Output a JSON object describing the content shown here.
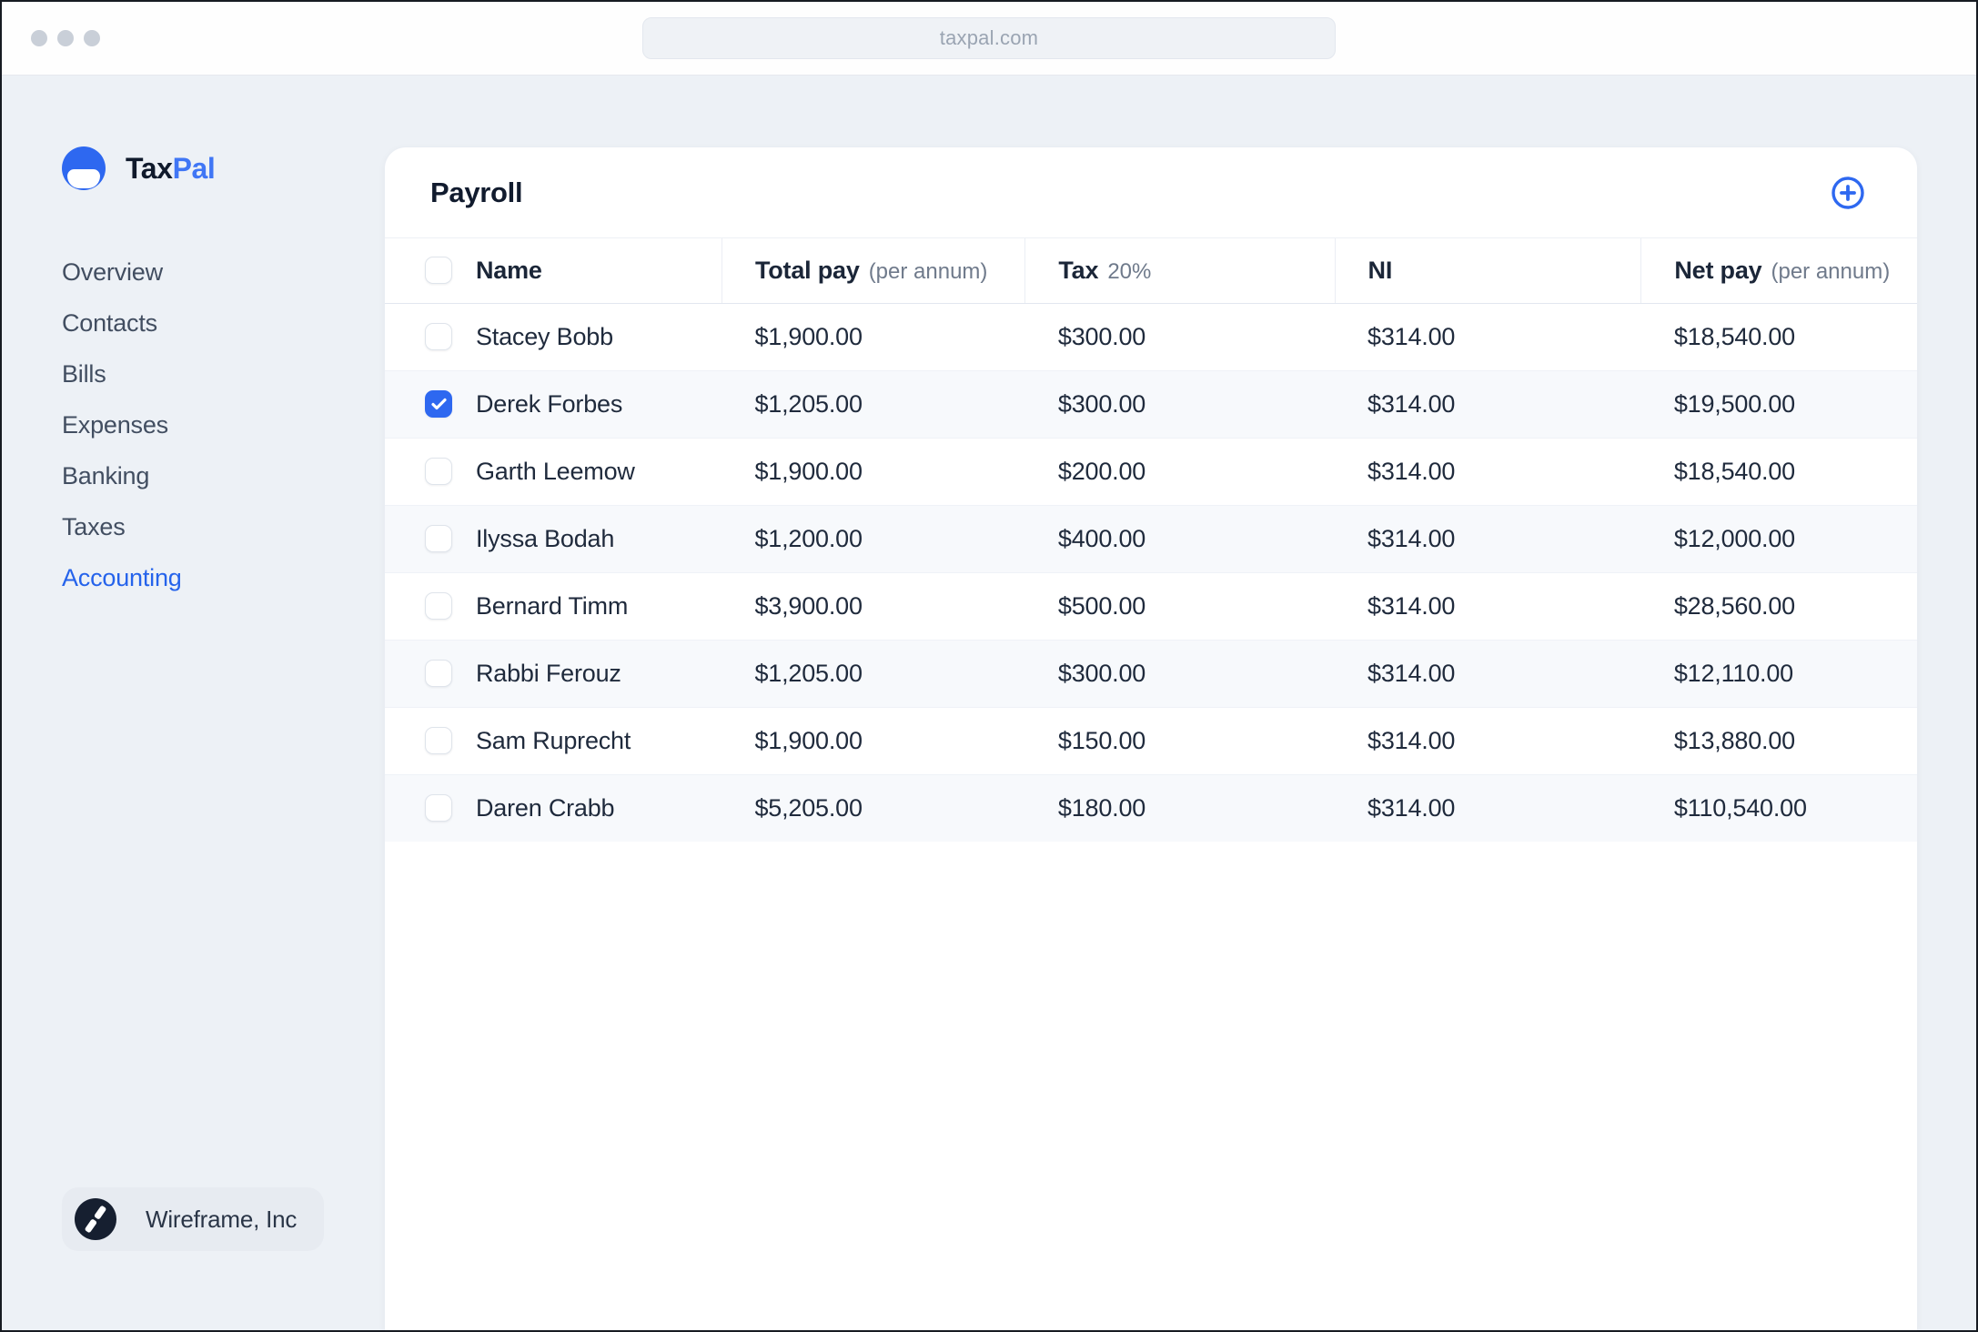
{
  "browser": {
    "url": "taxpal.com"
  },
  "brand": {
    "name_primary": "Tax",
    "name_secondary": "Pal",
    "logo_icon": "blue-circle-smile-icon"
  },
  "sidebar": {
    "items": [
      {
        "label": "Overview",
        "active": false
      },
      {
        "label": "Contacts",
        "active": false
      },
      {
        "label": "Bills",
        "active": false
      },
      {
        "label": "Expenses",
        "active": false
      },
      {
        "label": "Banking",
        "active": false
      },
      {
        "label": "Taxes",
        "active": false
      },
      {
        "label": "Accounting",
        "active": true
      }
    ],
    "org": {
      "name": "Wireframe, Inc",
      "logo_icon": "dark-circle-double-slash-icon"
    }
  },
  "main": {
    "title": "Payroll",
    "add_button_icon": "circle-plus-icon",
    "table": {
      "columns": [
        {
          "label": "Name",
          "sub": ""
        },
        {
          "label": "Total pay",
          "sub": "(per annum)"
        },
        {
          "label": "Tax",
          "sub": "20%"
        },
        {
          "label": "NI",
          "sub": ""
        },
        {
          "label": "Net pay",
          "sub": "(per annum)"
        }
      ],
      "rows": [
        {
          "checked": false,
          "name": "Stacey Bobb",
          "total_pay": "$1,900.00",
          "tax": "$300.00",
          "ni": "$314.00",
          "net_pay": "$18,540.00"
        },
        {
          "checked": true,
          "name": "Derek Forbes",
          "total_pay": "$1,205.00",
          "tax": "$300.00",
          "ni": "$314.00",
          "net_pay": "$19,500.00"
        },
        {
          "checked": false,
          "name": "Garth Leemow",
          "total_pay": "$1,900.00",
          "tax": "$200.00",
          "ni": "$314.00",
          "net_pay": "$18,540.00"
        },
        {
          "checked": false,
          "name": "Ilyssa Bodah",
          "total_pay": "$1,200.00",
          "tax": "$400.00",
          "ni": "$314.00",
          "net_pay": "$12,000.00"
        },
        {
          "checked": false,
          "name": "Bernard Timm",
          "total_pay": "$3,900.00",
          "tax": "$500.00",
          "ni": "$314.00",
          "net_pay": "$28,560.00"
        },
        {
          "checked": false,
          "name": "Rabbi Ferouz",
          "total_pay": "$1,205.00",
          "tax": "$300.00",
          "ni": "$314.00",
          "net_pay": "$12,110.00"
        },
        {
          "checked": false,
          "name": "Sam Ruprecht",
          "total_pay": "$1,900.00",
          "tax": "$150.00",
          "ni": "$314.00",
          "net_pay": "$13,880.00"
        },
        {
          "checked": false,
          "name": "Daren Crabb",
          "total_pay": "$5,205.00",
          "tax": "$180.00",
          "ni": "$314.00",
          "net_pay": "$110,540.00"
        }
      ]
    }
  },
  "colors": {
    "accent_blue": "#2e68f0",
    "brand_pal_blue": "#4076f5",
    "active_nav_blue": "#2563eb",
    "page_background": "#edf1f6",
    "text_dark": "#111b2e"
  }
}
